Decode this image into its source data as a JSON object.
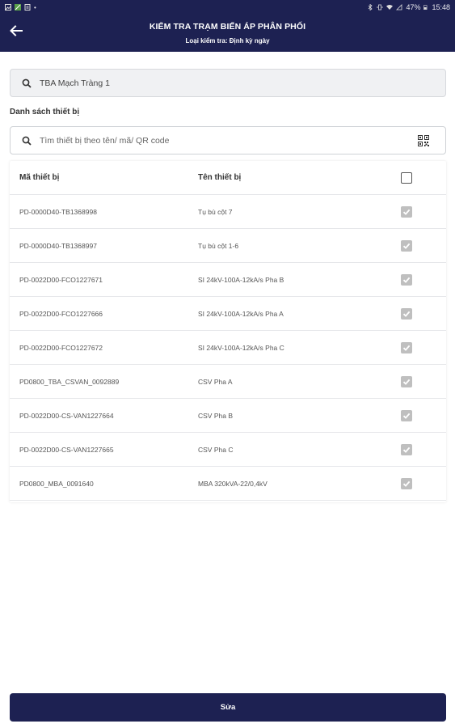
{
  "status_bar": {
    "battery": "47%",
    "time": "15:48"
  },
  "header": {
    "title": "KIỂM TRA TRẠM BIẾN ÁP PHÂN PHỐI",
    "subtitle": "Loại kiểm tra: Định kỳ ngày"
  },
  "station": {
    "value": "TBA Mạch Tràng 1"
  },
  "device_list": {
    "label": "Danh sách thiết bị",
    "search_placeholder": "Tìm thiết bị theo tên/ mã/ QR code",
    "columns": {
      "code": "Mã thiết bị",
      "name": "Tên thiết bị"
    },
    "rows": [
      {
        "code": "PD-0000D40-TB1368998",
        "name": "Tụ bù cột 7",
        "checked": true
      },
      {
        "code": "PD-0000D40-TB1368997",
        "name": "Tụ bù cột 1-6",
        "checked": true
      },
      {
        "code": "PD-0022D00-FCO1227671",
        "name": "SI 24kV-100A-12kA/s Pha B",
        "checked": true
      },
      {
        "code": "PD-0022D00-FCO1227666",
        "name": "SI 24kV-100A-12kA/s Pha A",
        "checked": true
      },
      {
        "code": "PD-0022D00-FCO1227672",
        "name": "SI 24kV-100A-12kA/s Pha C",
        "checked": true
      },
      {
        "code": "PD0800_TBA_CSVAN_0092889",
        "name": "CSV Pha A",
        "checked": true
      },
      {
        "code": "PD-0022D00-CS-VAN1227664",
        "name": "CSV Pha B",
        "checked": true
      },
      {
        "code": "PD-0022D00-CS-VAN1227665",
        "name": "CSV Pha C",
        "checked": true
      },
      {
        "code": "PD0800_MBA_0091640",
        "name": "MBA 320kVA-22/0,4kV",
        "checked": true
      }
    ]
  },
  "actions": {
    "save_label": "Sửa"
  },
  "colors": {
    "primary": "#1d2152",
    "checked": "#bfbfbf"
  }
}
